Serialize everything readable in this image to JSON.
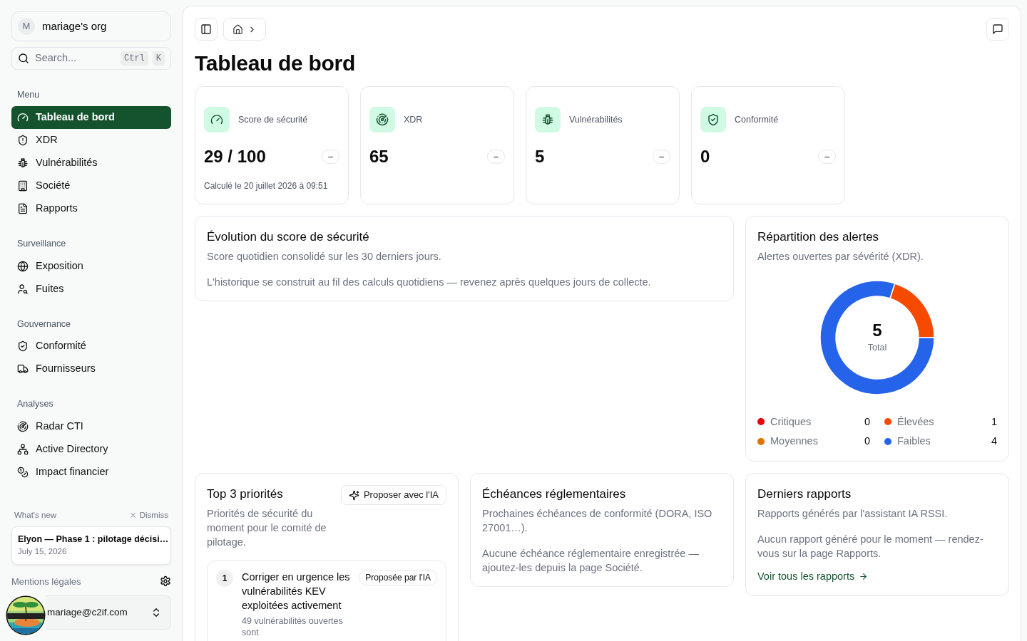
{
  "sidebar": {
    "org": {
      "avatar": "M",
      "name": "mariage's org"
    },
    "search": {
      "placeholder": "Search...",
      "keys": [
        "Ctrl",
        "K"
      ]
    },
    "sections": [
      {
        "title": "Menu",
        "items": [
          {
            "label": "Tableau de bord",
            "selected": true
          },
          {
            "label": "XDR",
            "selected": false
          },
          {
            "label": "Vulnérabilités",
            "selected": false
          },
          {
            "label": "Société",
            "selected": false
          },
          {
            "label": "Rapports",
            "selected": false
          }
        ]
      },
      {
        "title": "Surveillance",
        "items": [
          {
            "label": "Exposition",
            "selected": false
          },
          {
            "label": "Fuites",
            "selected": false
          }
        ]
      },
      {
        "title": "Gouvernance",
        "items": [
          {
            "label": "Conformité",
            "selected": false
          },
          {
            "label": "Fournisseurs",
            "selected": false
          }
        ]
      },
      {
        "title": "Analyses",
        "items": [
          {
            "label": "Radar CTI",
            "selected": false
          },
          {
            "label": "Active Directory",
            "selected": false
          },
          {
            "label": "Impact financier",
            "selected": false
          }
        ]
      }
    ],
    "whats_new": {
      "title": "What's new",
      "dismiss": "Dismiss",
      "entry": {
        "title": "Elyon — Phase 1 : pilotage décisi…",
        "date": "July 15, 2026"
      }
    },
    "legal_link": "Mentions légales",
    "user": {
      "email": "mariage@c2if.com"
    }
  },
  "page": {
    "title": "Tableau de bord"
  },
  "stats": [
    {
      "label": "Score de sécurité",
      "value": "29 / 100",
      "trend": "–",
      "note": "Calculé le 20 juillet 2026 à 09:51"
    },
    {
      "label": "XDR",
      "value": "65",
      "trend": "–"
    },
    {
      "label": "Vulnérabilités",
      "value": "5",
      "trend": "–"
    },
    {
      "label": "Conformité",
      "value": "0",
      "trend": "–"
    }
  ],
  "evolution": {
    "title": "Évolution du score de sécurité",
    "subtitle": "Score quotidien consolidé sur les 30 derniers jours.",
    "empty": "L'historique se construit au fil des calculs quotidiens — revenez après quelques jours de collecte."
  },
  "alerts": {
    "title": "Répartition des alertes",
    "subtitle": "Alertes ouvertes par sévérité (XDR).",
    "chart_data": {
      "type": "donut",
      "categories": [
        "Critiques",
        "Élevées",
        "Moyennes",
        "Faibles"
      ],
      "values": [
        0,
        20,
        0,
        80
      ]
    },
    "total": "5",
    "total_label": "Total",
    "legend": [
      {
        "count": "0",
        "color": "#e7000b"
      },
      {
        "count": "1",
        "color": "#f54a00"
      },
      {
        "count": "0",
        "color": "#e17100"
      },
      {
        "count": "4",
        "color": "#2563eb"
      }
    ]
  },
  "priorities": {
    "title": "Top 3 priorités",
    "subtitle": "Priorités de sécurité du moment pour le comité de pilotage.",
    "button": "Proposer avec l'IA",
    "items": [
      {
        "rank": "1",
        "title": "Corriger en urgence les vulnérabilités KEV exploitées activement",
        "badge": "Proposée par l'IA",
        "description": "49 vulnérabilités ouvertes sont"
      }
    ]
  },
  "deadlines": {
    "title": "Échéances réglementaires",
    "subtitle": "Prochaines échéances de conformité (DORA, ISO 27001…).",
    "empty": "Aucune échéance réglementaire enregistrée — ajoutez-les depuis la page Société."
  },
  "reports": {
    "title": "Derniers rapports",
    "subtitle": "Rapports générés par l'assistant IA RSSI.",
    "empty": "Aucun rapport généré pour le moment — rendez-vous sur la page Rapports.",
    "link": "Voir tous les rapports"
  }
}
